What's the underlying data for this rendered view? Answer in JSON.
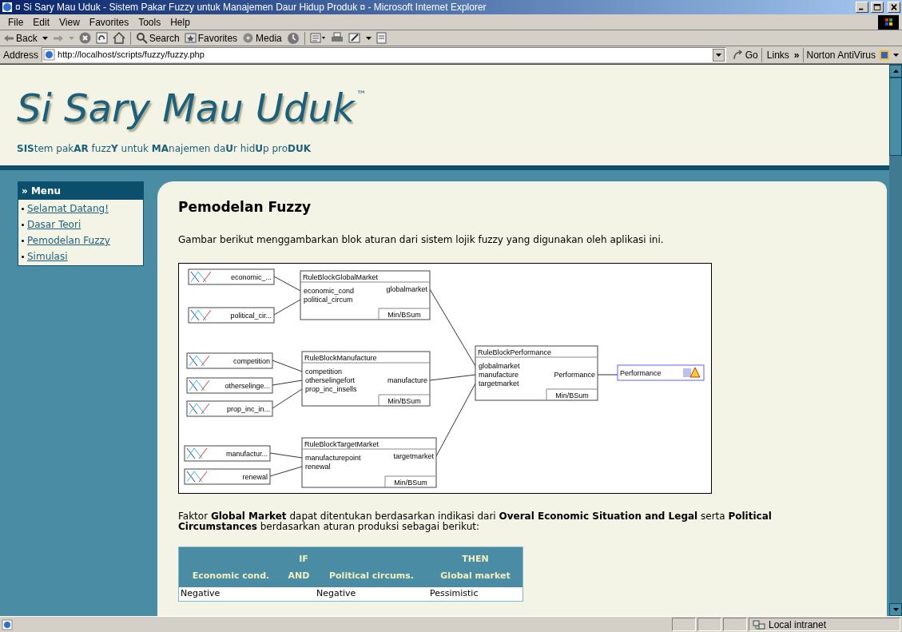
{
  "window": {
    "title": "¤ Si Sary Mau Uduk - Sistem Pakar Fuzzy untuk Manajemen Daur Hidup Produk ¤ - Microsoft Internet Explorer"
  },
  "menu_bar": [
    "File",
    "Edit",
    "View",
    "Favorites",
    "Tools",
    "Help"
  ],
  "toolbar": {
    "back": "Back",
    "search": "Search",
    "favorites": "Favorites",
    "media": "Media"
  },
  "address_bar": {
    "label": "Address",
    "url": "http://localhost/scripts/fuzzy/fuzzy.php",
    "go": "Go",
    "links": "Links",
    "links_more": "»",
    "norton": "Norton AntiVirus"
  },
  "header": {
    "logo": "Si Sary Mau Uduk",
    "trademark": "™",
    "tagline": "**SIS**tem pak**AR** fuzz**Y** untuk **MA**najemen da**U**r hid**U**p pro**DUK**"
  },
  "sidebar": {
    "title": "» Menu",
    "items": [
      {
        "label": "Selamat Datang!"
      },
      {
        "label": "Dasar Teori"
      },
      {
        "label": "Pemodelan Fuzzy"
      },
      {
        "label": "Simulasi"
      }
    ]
  },
  "main": {
    "heading": "Pemodelan Fuzzy",
    "intro": "Gambar berikut menggambarkan blok aturan dari sistem lojik fuzzy yang digunakan oleh aplikasi ini.",
    "diagram": {
      "rule_blocks": [
        {
          "title": "RuleBlockGlobalMarket",
          "output": "globalmarket",
          "method": "Min/BSum",
          "inputs": [
            {
              "name": "economic_cond",
              "variable": "economic_..."
            },
            {
              "name": "political_circum",
              "variable": "political_cir..."
            }
          ]
        },
        {
          "title": "RuleBlockManufacture",
          "output": "manufacture",
          "method": "Min/BSum",
          "inputs": [
            {
              "name": "competition",
              "variable": "competition"
            },
            {
              "name": "otherselingefort",
              "variable": "otherselinge..."
            },
            {
              "name": "prop_inc_insells",
              "variable": "prop_inc_in..."
            }
          ]
        },
        {
          "title": "RuleBlockTargetMarket",
          "output": "targetmarket",
          "method": "Min/BSum",
          "inputs": [
            {
              "name": "manufacturepoint",
              "variable": "manufactur..."
            },
            {
              "name": "renewal",
              "variable": "renewal"
            }
          ]
        }
      ],
      "final_block": {
        "title": "RuleBlockPerformance",
        "output": "Performance",
        "method": "Min/BSum",
        "inputs": [
          "globalmarket",
          "manufacture",
          "targetmarket"
        ]
      },
      "output_variable": "Performance"
    },
    "description": "Faktor **Global Market** dapat ditentukan berdasarkan indikasi dari **Overal Economic Situation and Legal** serta **Political Circumstances** berdasarkan aturan produksi sebagai berikut:",
    "table": {
      "group_headers": [
        "IF",
        "THEN"
      ],
      "columns": [
        "Economic cond.",
        "AND",
        "Political circums.",
        "Global market"
      ],
      "rows": [
        [
          "Negative",
          "",
          "Negative",
          "Pessimistic"
        ]
      ]
    }
  },
  "status_bar": {
    "zone": "Local intranet"
  }
}
